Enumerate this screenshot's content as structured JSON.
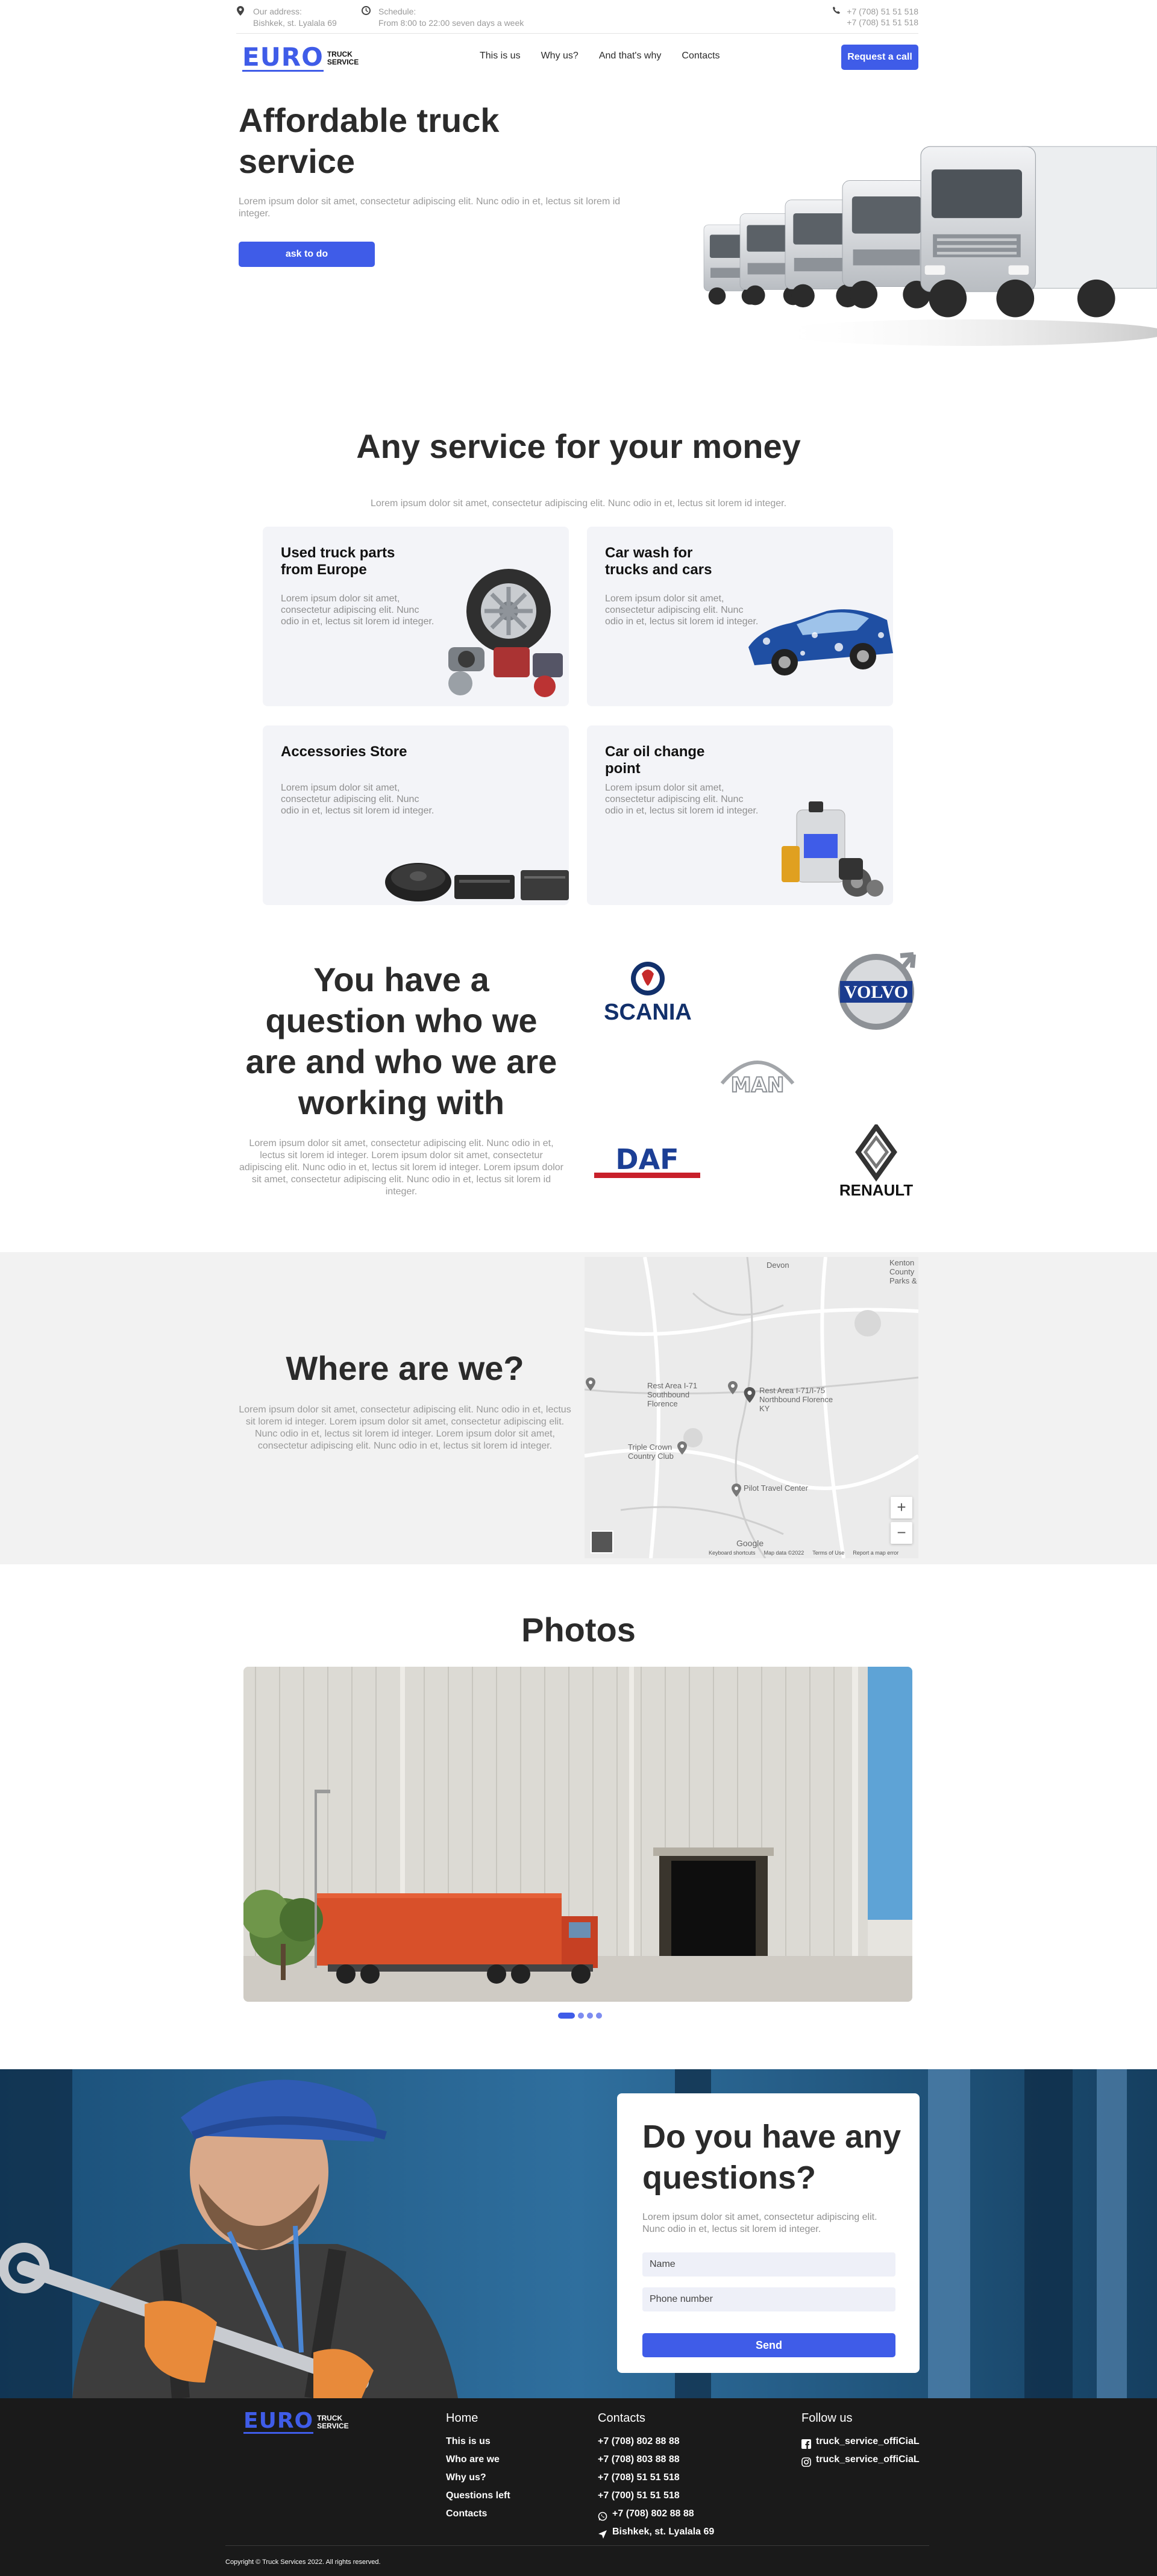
{
  "topbar": {
    "address_label": "Our address:",
    "address_value": "Bishkek, st. Lyalala 69",
    "schedule_label": "Schedule:",
    "schedule_value": "From 8:00 to 22:00 seven days a week",
    "phone_1": "+7 (708) 51 51 518",
    "phone_2": "+7 (708) 51 51 518"
  },
  "logo": {
    "main": "EURO",
    "line1": "TRUCK",
    "line2": "SERVICE"
  },
  "nav": {
    "items": [
      "This is us",
      "Why us?",
      "And that's why",
      "Contacts"
    ],
    "cta": "Request a call"
  },
  "hero": {
    "title": "Affordable truck service",
    "text": "Lorem ipsum dolor sit amet, consectetur adipiscing elit. Nunc odio in et, lectus sit lorem id integer.",
    "button": "ask to do"
  },
  "services": {
    "title": "Any service for your money",
    "text": "Lorem ipsum dolor sit amet, consectetur adipiscing elit. Nunc odio in et, lectus sit lorem id integer.",
    "cards": [
      {
        "title": "Used truck parts from Europe",
        "text": "Lorem ipsum dolor sit amet, consectetur adipiscing elit. Nunc odio in et, lectus sit lorem id integer."
      },
      {
        "title": "Car wash for trucks and cars",
        "text": "Lorem ipsum dolor sit amet, consectetur adipiscing elit. Nunc odio in et, lectus sit lorem id integer."
      },
      {
        "title": "Accessories Store",
        "text": "Lorem ipsum dolor sit amet, consectetur adipiscing elit. Nunc odio in et, lectus sit lorem id integer."
      },
      {
        "title": "Car oil change point",
        "text": "Lorem ipsum dolor sit amet, consectetur adipiscing elit. Nunc odio in et, lectus sit lorem id integer."
      }
    ]
  },
  "brands": {
    "title": "You have a question who we are and who we are working with",
    "text": "Lorem ipsum dolor sit amet, consectetur adipiscing elit. Nunc odio in et, lectus sit lorem id integer. Lorem ipsum dolor sit amet, consectetur adipiscing elit. Nunc odio in et, lectus sit lorem id integer. Lorem ipsum dolor sit amet, consectetur adipiscing elit. Nunc odio in et, lectus sit lorem id integer.",
    "logos": [
      "SCANIA",
      "VOLVO",
      "MAN",
      "DAF",
      "RENAULT"
    ]
  },
  "location": {
    "title": "Where are we?",
    "text": "Lorem ipsum dolor sit amet, consectetur adipiscing elit. Nunc odio in et, lectus sit lorem id integer. Lorem ipsum dolor sit amet, consectetur adipiscing elit. Nunc odio in et, lectus sit lorem id integer. Lorem ipsum dolor sit amet, consectetur adipiscing elit. Nunc odio in et, lectus sit lorem id integer.",
    "map": {
      "label_1": "Rest Area I-71 Southbound Florence",
      "label_2": "Rest Area I-71/I-75 Northbound Florence KY",
      "label_3": "Triple Crown Country Club",
      "label_4": "Pilot Travel Center",
      "label_5": "Devon",
      "label_6": "Kenton County Parks &",
      "zoom_in": "+",
      "zoom_out": "−",
      "brand": "Google",
      "footer_1": "Keyboard shortcuts",
      "footer_2": "Map data ©2022",
      "footer_3": "Terms of Use",
      "footer_4": "Report a map error"
    }
  },
  "photos": {
    "title": "Photos",
    "slides": 4,
    "active": 1
  },
  "contact": {
    "title": "Do you have any questions?",
    "text": "Lorem ipsum dolor sit amet, consectetur adipiscing elit. Nunc odio in et, lectus sit lorem id integer.",
    "name_placeholder": "Name",
    "phone_placeholder": "Phone number",
    "send": "Send"
  },
  "footer": {
    "home": {
      "heading": "Home",
      "items": [
        "This is us",
        "Who are we",
        "Why us?",
        "Questions left",
        "Contacts"
      ]
    },
    "contacts": {
      "heading": "Contacts",
      "items": [
        "+7 (708) 802 88 88",
        "+7 (708) 803 88 88",
        "+7 (708) 51 51 518",
        "+7 (700) 51 51 518"
      ],
      "whatsapp": "+7 (708) 802 88 88",
      "address": "Bishkek, st. Lyalala 69"
    },
    "follow": {
      "heading": "Follow us",
      "facebook": "truck_service_offiCiaL",
      "instagram": "truck_service_offiCiaL"
    },
    "copyright": "Copyright © Truck Services 2022. All rights reserved."
  },
  "colors": {
    "accent": "#3f5ce8",
    "footer_bg": "#1a1a1a",
    "card_bg": "#f3f4f8",
    "section_bg": "#f2f2f2"
  }
}
